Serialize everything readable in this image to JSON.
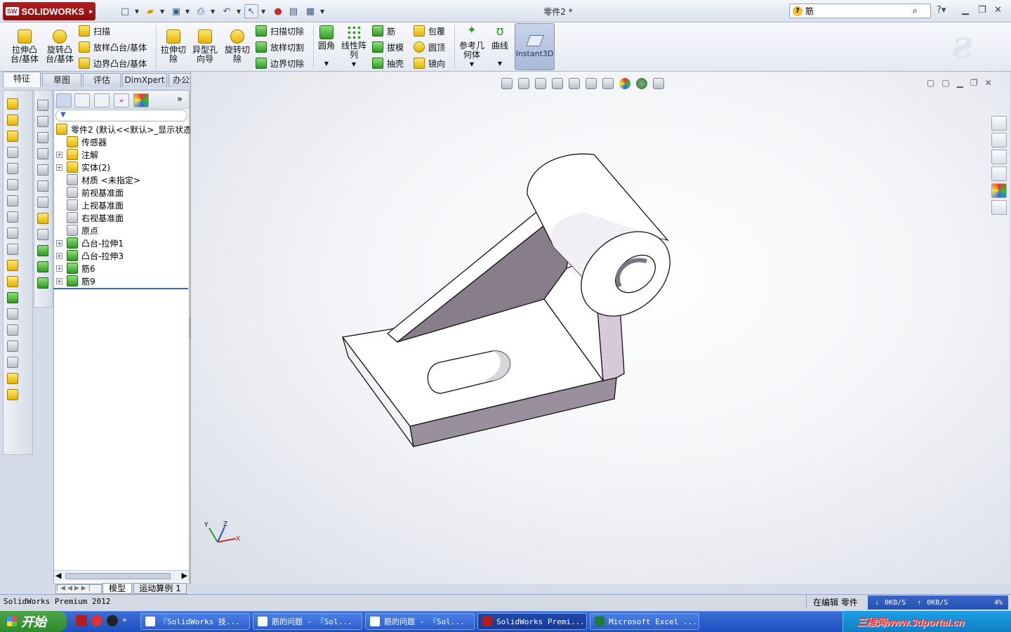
{
  "app": {
    "name": "SOLIDWORKS",
    "doc_title": "零件2 *"
  },
  "search": {
    "value": "筋"
  },
  "ribbon": {
    "big": [
      {
        "label": "拉伸凸\n台/基体"
      },
      {
        "label": "旋转凸\n台/基体"
      },
      {
        "label": "拉伸切\n除"
      },
      {
        "label": "异型孔\n向导"
      },
      {
        "label": "旋转切\n除"
      },
      {
        "label": "圆角"
      },
      {
        "label": "线性阵\n列"
      },
      {
        "label": "参考几\n何体"
      },
      {
        "label": "曲线"
      }
    ],
    "col1": [
      "扫描",
      "放样凸台/基体",
      "边界凸台/基体"
    ],
    "col2": [
      "扫描切除",
      "放样切割",
      "边界切除"
    ],
    "col3": [
      "筋",
      "拔模",
      "抽壳"
    ],
    "col4": [
      "包覆",
      "圆顶",
      "镜向"
    ],
    "instant3d": "Instant3D"
  },
  "tabs": [
    "特征",
    "草图",
    "评估",
    "DimXpert",
    "办公室产品"
  ],
  "tree": {
    "root": "零件2  (默认<<默认>_显示状态",
    "items": [
      {
        "label": "传感器",
        "expand": false
      },
      {
        "label": "注解",
        "expand": true
      },
      {
        "label": "实体(2)",
        "expand": true
      },
      {
        "label": "材质 <未指定>",
        "expand": false
      },
      {
        "label": "前视基准面",
        "expand": false
      },
      {
        "label": "上视基准面",
        "expand": false
      },
      {
        "label": "右视基准面",
        "expand": false
      },
      {
        "label": "原点",
        "expand": false
      },
      {
        "label": "凸台-拉伸1",
        "expand": true
      },
      {
        "label": "凸台-拉伸3",
        "expand": true
      },
      {
        "label": "筋6",
        "expand": true
      },
      {
        "label": "筋9",
        "expand": true
      }
    ],
    "bottom_tabs": [
      "模型",
      "运动算例 1"
    ]
  },
  "triad": {
    "x": "X",
    "y": "Y",
    "z": "Z"
  },
  "status": {
    "left": "SolidWorks Premium 2012",
    "editing": "在编辑 零件",
    "down": "0KB/S",
    "up": "0KB/S",
    "pct": "4%"
  },
  "taskbar": {
    "start": "开始",
    "items": [
      "『SolidWorks 技...",
      "筋的问题 - 『Sol...",
      "筋的问题 - 『Sol...",
      "SolidWorks Premi...",
      "Microsoft Excel ..."
    ],
    "watermark": "三维网www.3dportal.cn"
  },
  "colors": {
    "accent": "#3a66b5",
    "brand": "#b51d1d",
    "taskbar": "#2c5fcd"
  }
}
